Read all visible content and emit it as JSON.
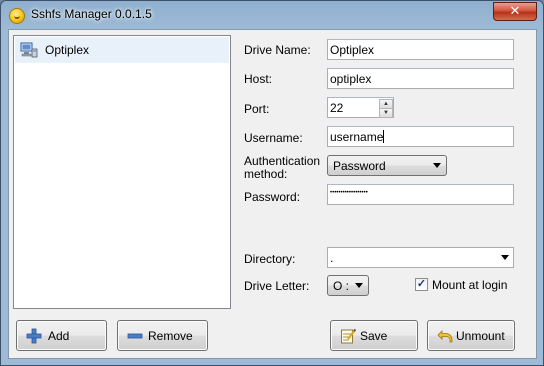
{
  "window": {
    "title": "Sshfs Manager 0.0.1.5",
    "close_glyph": "✕"
  },
  "connections": [
    {
      "name": "Optiplex",
      "icon": "computer-network-icon",
      "selected": true
    }
  ],
  "form": {
    "drive_name_label": "Drive Name:",
    "drive_name_value": "Optiplex",
    "host_label": "Host:",
    "host_value": "optiplex",
    "port_label": "Port:",
    "port_value": "22",
    "username_label": "Username:",
    "username_value": "username",
    "auth_label_line1": "Authentication",
    "auth_label_line2": "method:",
    "auth_value": "Password",
    "password_label": "Password:",
    "password_value": "••••••••••••••••••",
    "directory_label": "Directory:",
    "directory_value": ".",
    "drive_letter_label": "Drive Letter:",
    "drive_letter_value": "O :",
    "mount_at_login_label": "Mount at login",
    "mount_at_login_checked": true,
    "checkmark": "✓"
  },
  "buttons": {
    "add": "Add",
    "remove": "Remove",
    "save": "Save",
    "unmount": "Unmount"
  },
  "colors": {
    "titlebar": "#8fb0cf",
    "close_button": "#c9462f",
    "selection": "#e8f0fa"
  }
}
